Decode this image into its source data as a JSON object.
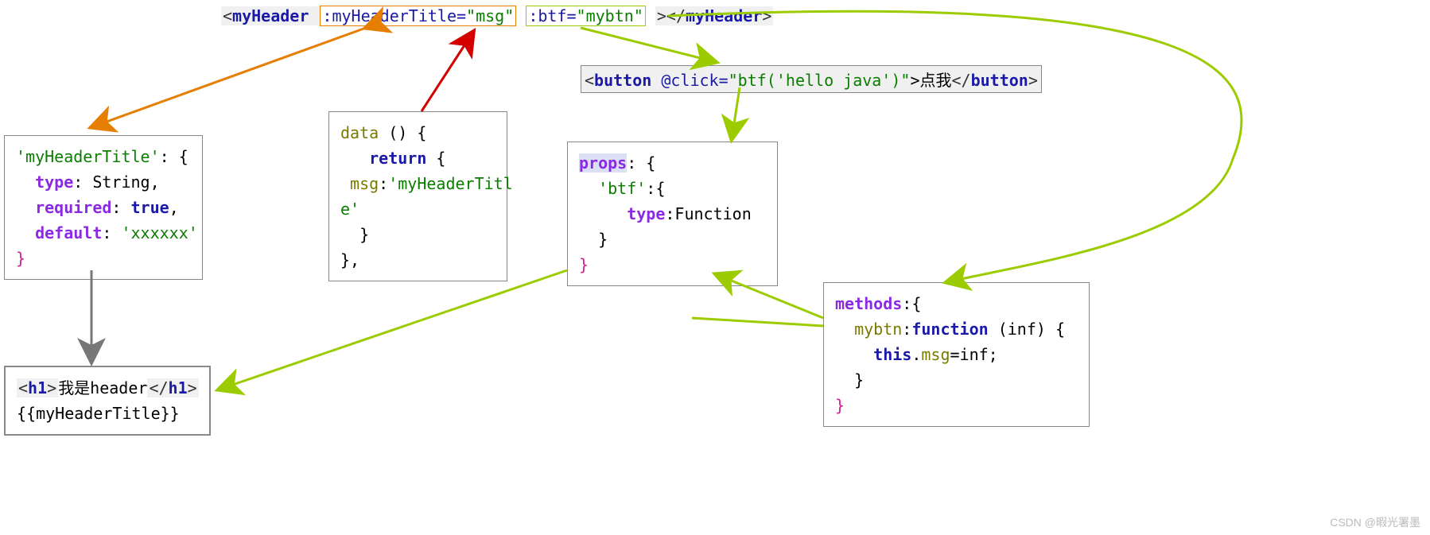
{
  "topLine": {
    "tagOpen": "<myHeader ",
    "attr1Name": ":myHeaderTitle=",
    "attr1Val": "\"msg\"",
    "attr2Name": ":btf=",
    "attr2Val": "\"mybtn\"",
    "tagClose": "></myHeader>"
  },
  "buttonLine": {
    "open": "<button ",
    "atClick": "@click=",
    "clickVal1": "\"btf(",
    "clickVal2": "'hello java'",
    "clickVal3": ")\"",
    "text": ">点我",
    "close": "</button>"
  },
  "box1": {
    "l1a": "'myHeaderTitle'",
    "l1b": ": {",
    "l2a": "  type",
    "l2b": ": String,",
    "l3a": "  required",
    "l3b": ": ",
    "l3c": "true",
    "l3d": ",",
    "l4a": "  default",
    "l4b": ": ",
    "l4c": "'xxxxxx'",
    "l5": "}"
  },
  "box2": {
    "l1a": "data",
    "l1b": " () {",
    "l2a": "   return",
    "l2b": " {",
    "l3a": " msg",
    "l3b": ":",
    "l3c": "'myHeaderTitl",
    "l4": "e'",
    "l5": "  }",
    "l6": "},"
  },
  "box3": {
    "l1a": "props",
    "l1b": ": {",
    "l2a": "  'btf'",
    "l2b": ":{",
    "l3a": "     type",
    "l3b": ":Function",
    "l4": "  }",
    "l5": "}"
  },
  "box4": {
    "l1a": "methods",
    "l1b": ":{",
    "l2a": "  mybtn",
    "l2b": ":",
    "l2c": "function",
    "l2d": " (inf) {",
    "l3a": "    this",
    "l3b": ".",
    "l3c": "msg",
    "l3d": "=inf;",
    "l4": "  }",
    "l5": "}"
  },
  "box5": {
    "l1a": "<h1>",
    "l1b": "我是header",
    "l1c": "</h1>",
    "l2": "{{myHeaderTitle}}"
  },
  "watermark": "CSDN @暇光署墨"
}
